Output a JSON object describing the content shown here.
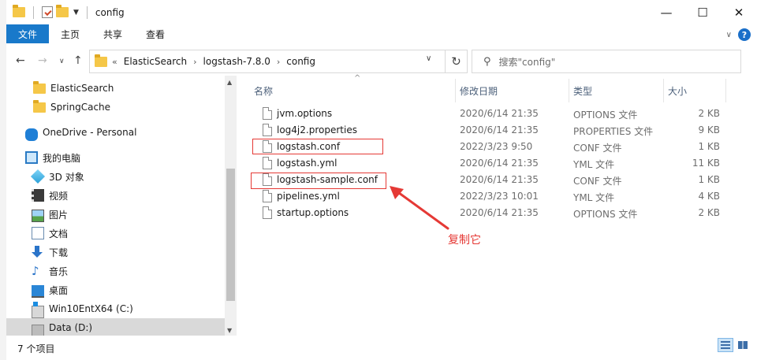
{
  "window": {
    "title": "config",
    "controls": {
      "minimize": "—",
      "maximize": "☐",
      "close": "✕"
    }
  },
  "ribbon": {
    "tabs": [
      "文件",
      "主页",
      "共享",
      "查看"
    ],
    "active_tab": "文件",
    "help": "?"
  },
  "address": {
    "overflow": "«",
    "crumbs": [
      "ElasticSearch",
      "logstash-7.8.0",
      "config"
    ],
    "search_placeholder": "搜索\"config\""
  },
  "nav": {
    "items": [
      {
        "label": "ElasticSearch",
        "icon": "folder-icon"
      },
      {
        "label": "SpringCache",
        "icon": "folder-icon"
      },
      {
        "label": "OneDrive - Personal",
        "icon": "onedrive-cloud-icon"
      },
      {
        "label": "我的电脑",
        "icon": "computer-icon"
      },
      {
        "label": "3D 对象",
        "icon": "3d-objects-icon"
      },
      {
        "label": "视频",
        "icon": "video-icon"
      },
      {
        "label": "图片",
        "icon": "picture-icon"
      },
      {
        "label": "文档",
        "icon": "document-icon"
      },
      {
        "label": "下载",
        "icon": "download-icon"
      },
      {
        "label": "音乐",
        "icon": "music-icon"
      },
      {
        "label": "桌面",
        "icon": "desktop-icon"
      },
      {
        "label": "Win10EntX64 (C:)",
        "icon": "windows-drive-icon"
      },
      {
        "label": "Data (D:)",
        "icon": "drive-icon"
      }
    ],
    "selected": "Data (D:)"
  },
  "files": {
    "columns": {
      "name": "名称",
      "date": "修改日期",
      "type": "类型",
      "size": "大小"
    },
    "rows": [
      {
        "name": "jvm.options",
        "date": "2020/6/14 21:35",
        "type": "OPTIONS 文件",
        "size": "2 KB"
      },
      {
        "name": "log4j2.properties",
        "date": "2020/6/14 21:35",
        "type": "PROPERTIES 文件",
        "size": "9 KB"
      },
      {
        "name": "logstash.conf",
        "date": "2022/3/23 9:50",
        "type": "CONF 文件",
        "size": "1 KB"
      },
      {
        "name": "logstash.yml",
        "date": "2020/6/14 21:35",
        "type": "YML 文件",
        "size": "11 KB"
      },
      {
        "name": "logstash-sample.conf",
        "date": "2020/6/14 21:35",
        "type": "CONF 文件",
        "size": "1 KB"
      },
      {
        "name": "pipelines.yml",
        "date": "2022/3/23 10:01",
        "type": "YML 文件",
        "size": "4 KB"
      },
      {
        "name": "startup.options",
        "date": "2020/6/14 21:35",
        "type": "OPTIONS 文件",
        "size": "2 KB"
      }
    ]
  },
  "annotation": {
    "text": "复制它",
    "color": "#e53935",
    "highlighted": [
      "logstash.conf",
      "logstash-sample.conf"
    ]
  },
  "status": {
    "count": "7 个项目"
  },
  "colors": {
    "accent": "#1979ca",
    "annotation": "#e53935"
  }
}
